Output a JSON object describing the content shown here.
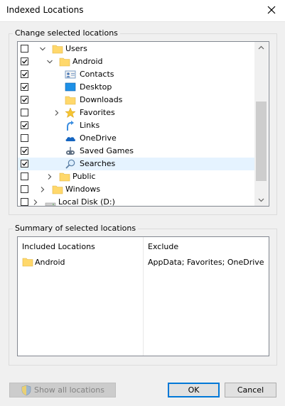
{
  "window": {
    "title": "Indexed Locations"
  },
  "change_group": {
    "label": "Change selected locations",
    "rows": [
      {
        "label": "Users",
        "checked": false,
        "expander": "expanded",
        "icon": "folder-icon",
        "selected": false
      },
      {
        "label": "Android",
        "checked": true,
        "expander": "expanded",
        "icon": "folder-icon",
        "selected": false
      },
      {
        "label": "Contacts",
        "checked": true,
        "expander": "none",
        "icon": "contacts-icon",
        "selected": false
      },
      {
        "label": "Desktop",
        "checked": true,
        "expander": "none",
        "icon": "desktop-icon",
        "selected": false
      },
      {
        "label": "Downloads",
        "checked": true,
        "expander": "none",
        "icon": "folder-icon",
        "selected": false
      },
      {
        "label": "Favorites",
        "checked": false,
        "expander": "collapsed",
        "icon": "star-icon",
        "selected": false
      },
      {
        "label": "Links",
        "checked": true,
        "expander": "none",
        "icon": "links-icon",
        "selected": false
      },
      {
        "label": "OneDrive",
        "checked": false,
        "expander": "none",
        "icon": "cloud-icon",
        "selected": false
      },
      {
        "label": "Saved Games",
        "checked": true,
        "expander": "none",
        "icon": "saved-games-icon",
        "selected": false
      },
      {
        "label": "Searches",
        "checked": true,
        "expander": "none",
        "icon": "search-icon",
        "selected": true
      },
      {
        "label": "Public",
        "checked": false,
        "expander": "collapsed",
        "icon": "folder-icon",
        "selected": false
      },
      {
        "label": "Windows",
        "checked": false,
        "expander": "collapsed",
        "icon": "folder-icon",
        "selected": false
      },
      {
        "label": "Local Disk (D:)",
        "checked": false,
        "expander": "collapsed",
        "icon": "drive-icon",
        "selected": false
      }
    ]
  },
  "summary_group": {
    "label": "Summary of selected locations",
    "included_header": "Included Locations",
    "exclude_header": "Exclude",
    "included": [
      {
        "label": "Android",
        "icon": "folder-icon"
      }
    ],
    "exclude": "AppData; Favorites; OneDrive"
  },
  "buttons": {
    "show_all": "Show all locations",
    "ok": "OK",
    "cancel": "Cancel"
  },
  "colors": {
    "accent": "#0078d7",
    "folder": "#ffd86b",
    "selection": "#e5f3ff"
  }
}
